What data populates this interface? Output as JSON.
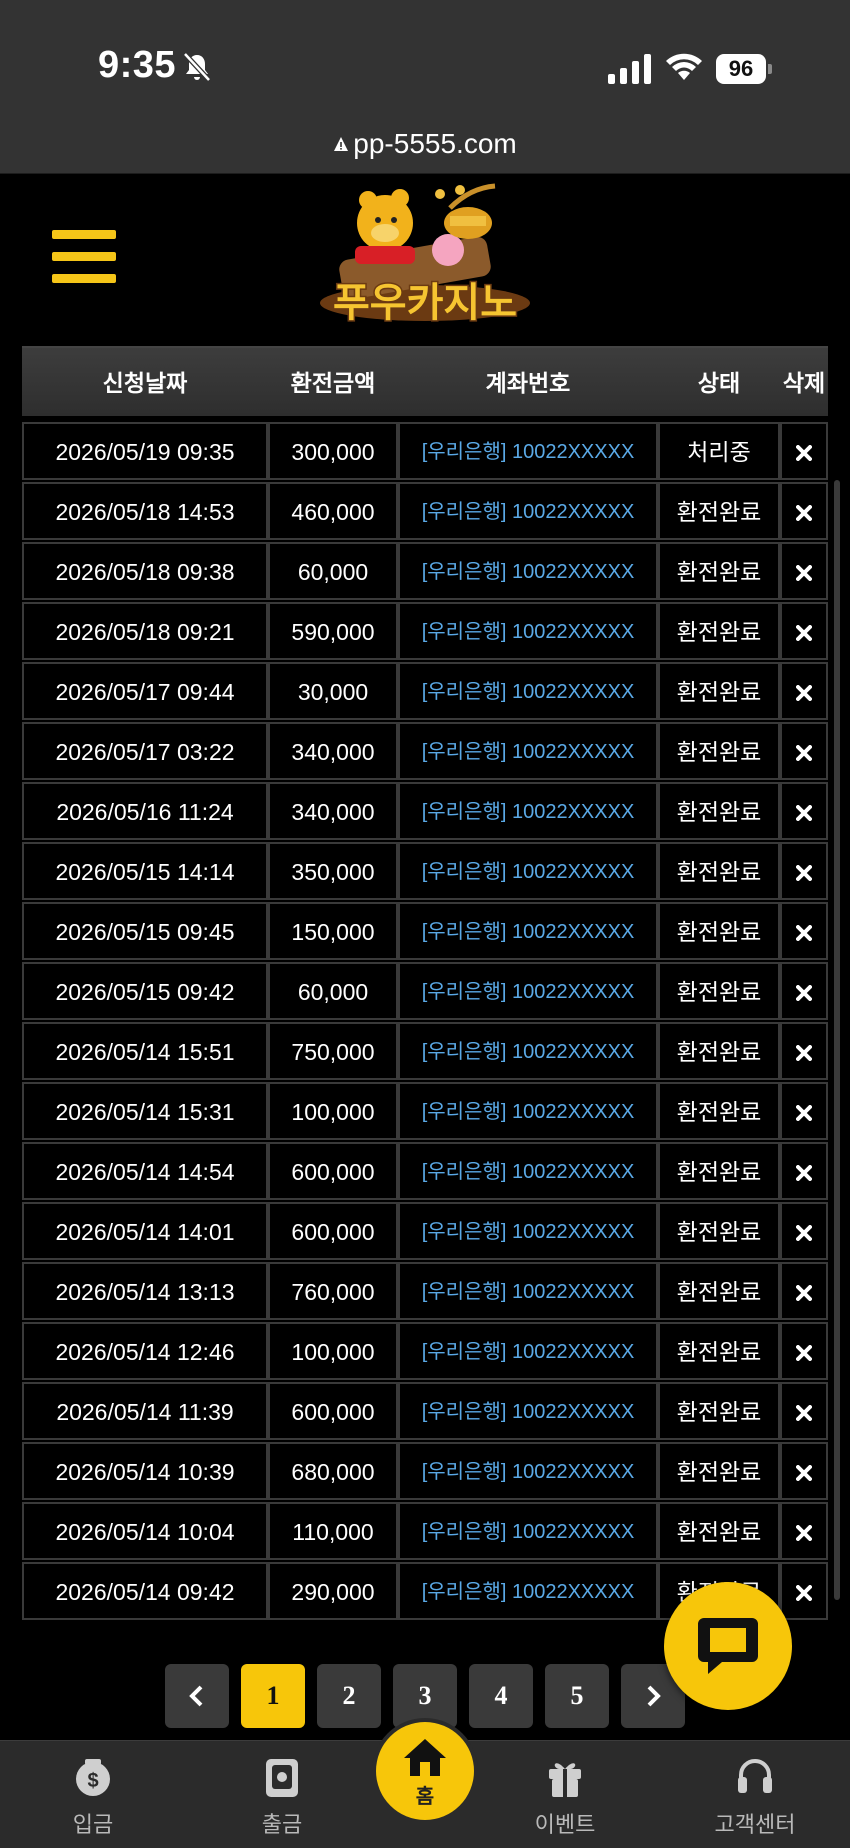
{
  "status_bar": {
    "time": "9:35",
    "battery": "96"
  },
  "browser": {
    "url": "pp-5555.com"
  },
  "header": {
    "logo_alt": "푸우카지노"
  },
  "table": {
    "headers": [
      "신청날짜",
      "환전금액",
      "계좌번호",
      "상태",
      "삭제"
    ],
    "rows": [
      {
        "date": "2026/05/19 09:35",
        "amount": "300,000",
        "account": "[우리은행] 10022XXXXX",
        "status": "처리중"
      },
      {
        "date": "2026/05/18 14:53",
        "amount": "460,000",
        "account": "[우리은행] 10022XXXXX",
        "status": "환전완료"
      },
      {
        "date": "2026/05/18 09:38",
        "amount": "60,000",
        "account": "[우리은행] 10022XXXXX",
        "status": "환전완료"
      },
      {
        "date": "2026/05/18 09:21",
        "amount": "590,000",
        "account": "[우리은행] 10022XXXXX",
        "status": "환전완료"
      },
      {
        "date": "2026/05/17 09:44",
        "amount": "30,000",
        "account": "[우리은행] 10022XXXXX",
        "status": "환전완료"
      },
      {
        "date": "2026/05/17 03:22",
        "amount": "340,000",
        "account": "[우리은행] 10022XXXXX",
        "status": "환전완료"
      },
      {
        "date": "2026/05/16 11:24",
        "amount": "340,000",
        "account": "[우리은행] 10022XXXXX",
        "status": "환전완료"
      },
      {
        "date": "2026/05/15 14:14",
        "amount": "350,000",
        "account": "[우리은행] 10022XXXXX",
        "status": "환전완료"
      },
      {
        "date": "2026/05/15 09:45",
        "amount": "150,000",
        "account": "[우리은행] 10022XXXXX",
        "status": "환전완료"
      },
      {
        "date": "2026/05/15 09:42",
        "amount": "60,000",
        "account": "[우리은행] 10022XXXXX",
        "status": "환전완료"
      },
      {
        "date": "2026/05/14 15:51",
        "amount": "750,000",
        "account": "[우리은행] 10022XXXXX",
        "status": "환전완료"
      },
      {
        "date": "2026/05/14 15:31",
        "amount": "100,000",
        "account": "[우리은행] 10022XXXXX",
        "status": "환전완료"
      },
      {
        "date": "2026/05/14 14:54",
        "amount": "600,000",
        "account": "[우리은행] 10022XXXXX",
        "status": "환전완료"
      },
      {
        "date": "2026/05/14 14:01",
        "amount": "600,000",
        "account": "[우리은행] 10022XXXXX",
        "status": "환전완료"
      },
      {
        "date": "2026/05/14 13:13",
        "amount": "760,000",
        "account": "[우리은행] 10022XXXXX",
        "status": "환전완료"
      },
      {
        "date": "2026/05/14 12:46",
        "amount": "100,000",
        "account": "[우리은행] 10022XXXXX",
        "status": "환전완료"
      },
      {
        "date": "2026/05/14 11:39",
        "amount": "600,000",
        "account": "[우리은행] 10022XXXXX",
        "status": "환전완료"
      },
      {
        "date": "2026/05/14 10:39",
        "amount": "680,000",
        "account": "[우리은행] 10022XXXXX",
        "status": "환전완료"
      },
      {
        "date": "2026/05/14 10:04",
        "amount": "110,000",
        "account": "[우리은행] 10022XXXXX",
        "status": "환전완료"
      },
      {
        "date": "2026/05/14 09:42",
        "amount": "290,000",
        "account": "[우리은행] 10022XXXXX",
        "status": "환전완료"
      }
    ]
  },
  "pagination": {
    "pages": [
      "1",
      "2",
      "3",
      "4",
      "5"
    ],
    "active": "1"
  },
  "bottom_nav": {
    "deposit": "입금",
    "withdraw": "출금",
    "home": "홈",
    "event": "이벤트",
    "support": "고객센터"
  },
  "colors": {
    "accent": "#f7c60a",
    "account_text": "#5aa9e6",
    "background": "#000000"
  }
}
